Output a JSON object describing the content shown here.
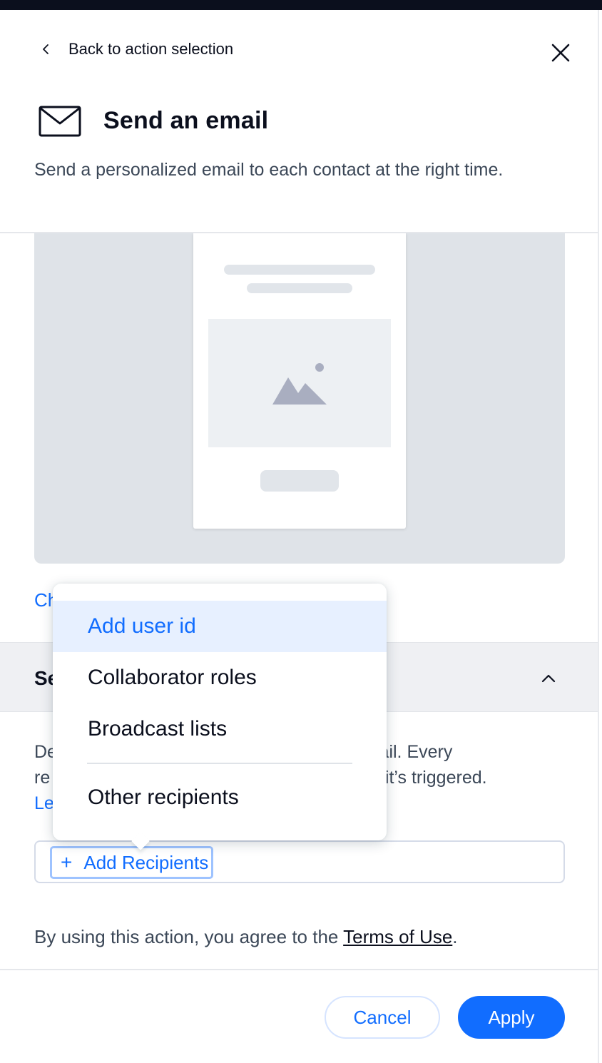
{
  "header": {
    "back_label": "Back to action selection",
    "title": "Send an email",
    "subtitle": "Send a personalized email to each contact at the right time."
  },
  "preview": {
    "change_link": "Ch"
  },
  "section": {
    "title": "Se",
    "description_line1_start": "De",
    "description_line1_end": "d email. Every",
    "description_line2_start": "re",
    "description_line2_end": "me it’s triggered.",
    "learn_more": "Le"
  },
  "recipients": {
    "add_label": "Add Recipients"
  },
  "dropdown": {
    "items": [
      {
        "label": "Add user id"
      },
      {
        "label": "Collaborator roles"
      },
      {
        "label": "Broadcast lists"
      },
      {
        "label": "Other recipients"
      }
    ]
  },
  "terms": {
    "prefix": "By using this action, you agree to the ",
    "link": "Terms of Use",
    "suffix": "."
  },
  "footer": {
    "cancel": "Cancel",
    "apply": "Apply"
  },
  "colors": {
    "accent": "#116dff",
    "dark": "#0b0f1d",
    "highlight": "#e7f0ff"
  }
}
